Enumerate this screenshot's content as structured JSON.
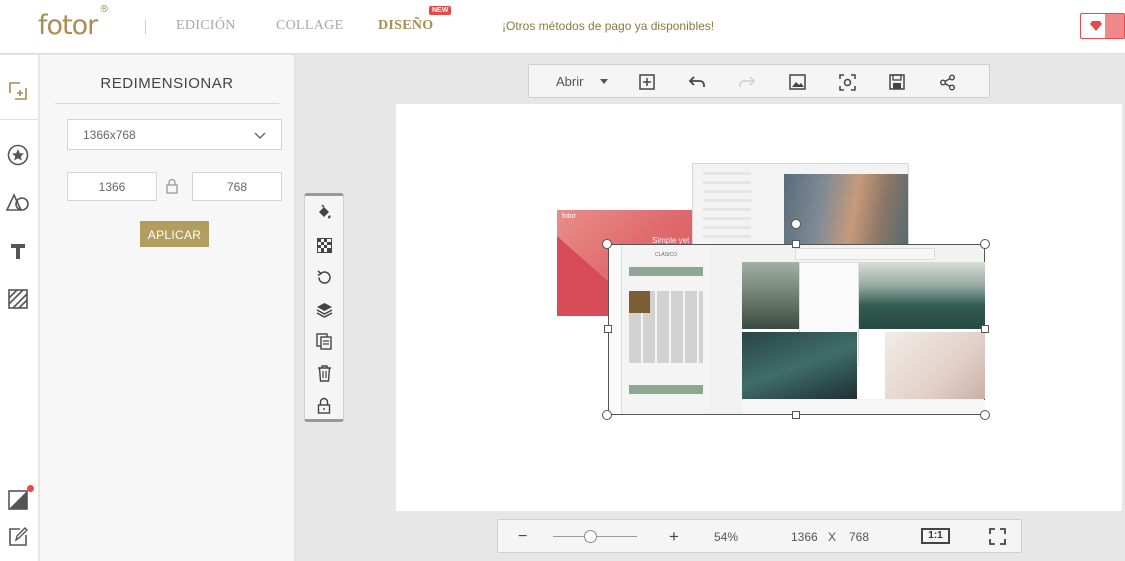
{
  "header": {
    "logo": "fotor",
    "logo_mark": "®",
    "nav": [
      {
        "label": "EDICIÓN",
        "active": false
      },
      {
        "label": "COLLAGE",
        "active": false
      },
      {
        "label": "DISEÑO",
        "active": true
      }
    ],
    "new_badge": "NEW",
    "promo_text": "¡Otros métodos de pago ya disponibles!"
  },
  "panel": {
    "title": "REDIMENSIONAR",
    "preset": "1366x768",
    "width": "1366",
    "height": "768",
    "apply_label": "APLICAR"
  },
  "toolbar": {
    "open_label": "Abrir"
  },
  "canvas": {
    "thumb_logo": "fotor",
    "thumb_text": "Simple yet",
    "inner_panel_title": "CLÁSICO"
  },
  "zoom": {
    "minus": "−",
    "plus": "+",
    "percent": "54%",
    "width": "1366",
    "x": "X",
    "height": "768",
    "one_to_one": "1:1",
    "level": 0.54
  },
  "colors": {
    "brand": "#a88d55",
    "apply_button": "#b29c5e",
    "badge": "#e8484a"
  },
  "icons": {
    "rail": [
      "add-frame-icon",
      "star-icon",
      "shapes-icon",
      "text-icon",
      "background-pattern-icon",
      "layout-icon",
      "edit-icon"
    ],
    "toolbar": [
      "add-icon",
      "undo-icon",
      "redo-icon",
      "image-icon",
      "focus-icon",
      "save-icon",
      "share-icon"
    ],
    "vertical_tools": [
      "fill-icon",
      "transparency-icon",
      "rotate-icon",
      "layers-icon",
      "copy-icon",
      "delete-icon",
      "lock-icon"
    ]
  }
}
